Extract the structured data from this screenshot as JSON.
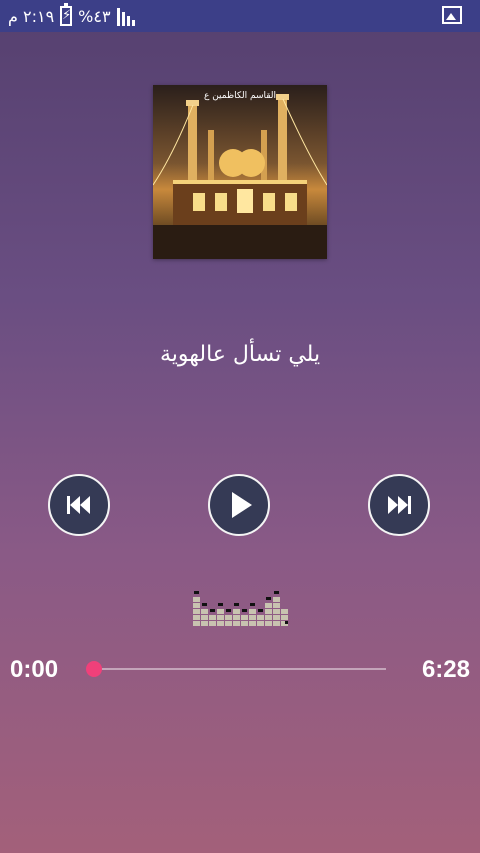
{
  "status_bar": {
    "time": "٢:١٩ م",
    "battery_percent": "%٤٣",
    "icons": [
      "signal-icon",
      "battery-charging-icon",
      "gallery-icon"
    ]
  },
  "cover": {
    "caption": "القاسم الكاظمين ع"
  },
  "player": {
    "title": "يلي تسأل عالهوية",
    "time_current": "0:00",
    "time_total": "6:28",
    "progress": 0.0,
    "buttons": [
      "previous-icon",
      "play-icon",
      "next-icon"
    ]
  },
  "colors": {
    "status_bar": "#3c3f88",
    "button_bg": "#353a55",
    "seek_thumb": "#f0407a",
    "background_top": "#55406f",
    "background_bottom": "#a3607a"
  }
}
